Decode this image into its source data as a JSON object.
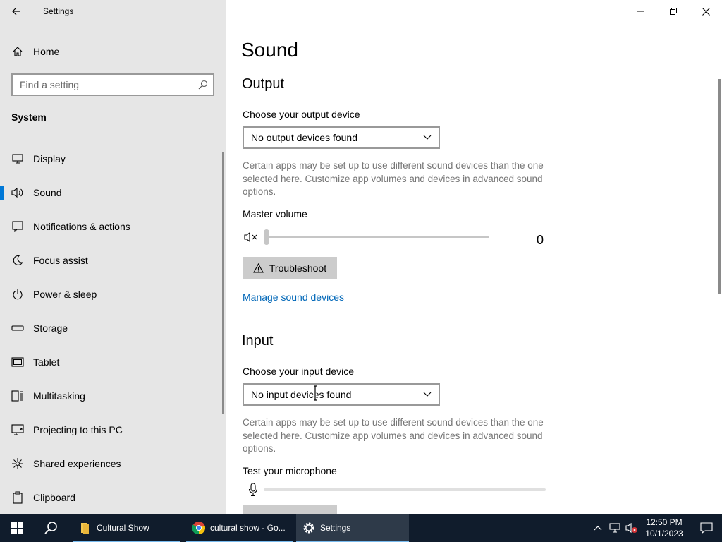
{
  "window": {
    "title": "Settings"
  },
  "sidebar": {
    "home_label": "Home",
    "search_placeholder": "Find a setting",
    "section": "System",
    "items": [
      {
        "label": "Display",
        "icon": "monitor-icon"
      },
      {
        "label": "Sound",
        "icon": "speaker-icon",
        "active": true
      },
      {
        "label": "Notifications & actions",
        "icon": "notification-icon"
      },
      {
        "label": "Focus assist",
        "icon": "moon-icon"
      },
      {
        "label": "Power & sleep",
        "icon": "power-icon"
      },
      {
        "label": "Storage",
        "icon": "storage-icon"
      },
      {
        "label": "Tablet",
        "icon": "tablet-icon"
      },
      {
        "label": "Multitasking",
        "icon": "multitasking-icon"
      },
      {
        "label": "Projecting to this PC",
        "icon": "projecting-icon"
      },
      {
        "label": "Shared experiences",
        "icon": "shared-icon"
      },
      {
        "label": "Clipboard",
        "icon": "clipboard-icon"
      }
    ]
  },
  "content": {
    "title": "Sound",
    "output": {
      "heading": "Output",
      "device_label": "Choose your output device",
      "device_value": "No output devices found",
      "description": "Certain apps may be set up to use different sound devices than the one selected here. Customize app volumes and devices in advanced sound options.",
      "master_volume_label": "Master volume",
      "volume_value": "0",
      "troubleshoot_label": "Troubleshoot",
      "manage_link": "Manage sound devices"
    },
    "input": {
      "heading": "Input",
      "device_label": "Choose your input device",
      "device_value": "No input devices found",
      "description": "Certain apps may be set up to use different sound devices than the one selected here. Customize app volumes and devices in advanced sound options.",
      "test_label": "Test your microphone"
    }
  },
  "taskbar": {
    "apps": [
      {
        "label": "Cultural Show",
        "icon": "folder-icon"
      },
      {
        "label": "cultural show - Go...",
        "icon": "chrome-icon"
      },
      {
        "label": "Settings",
        "icon": "gear-icon",
        "active": true
      }
    ],
    "clock": {
      "time": "12:50 PM",
      "date": "10/1/2023"
    }
  },
  "colors": {
    "accent": "#0078d7",
    "link": "#0067b8",
    "sidebar_bg": "#e6e6e6",
    "taskbar_bg": "#101c2c"
  }
}
